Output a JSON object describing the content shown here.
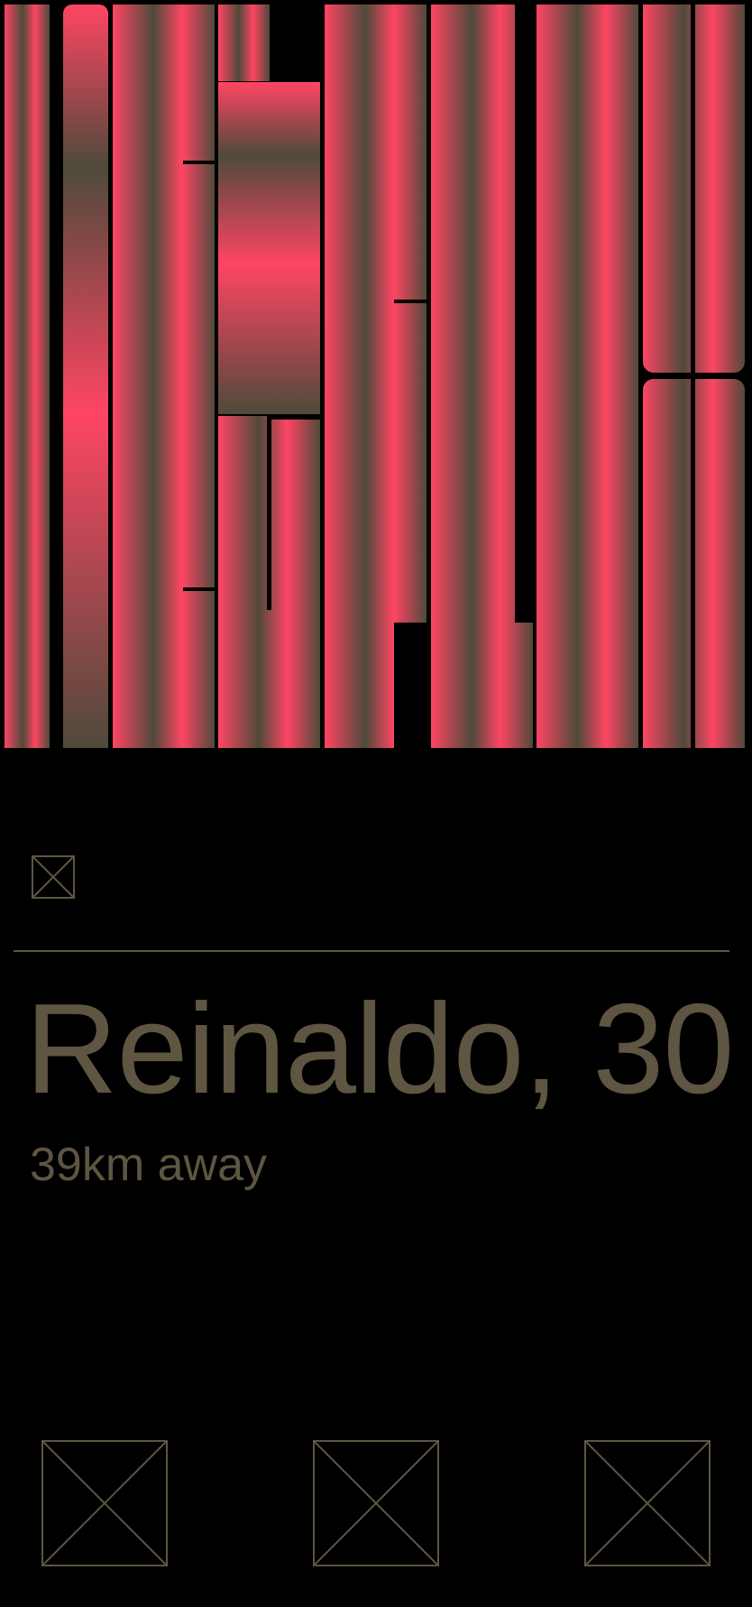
{
  "profile": {
    "name_age": "Reinaldo, 30",
    "distance": "39km away"
  },
  "icons": {
    "header": "image-placeholder-icon",
    "actions": [
      "image-placeholder-icon",
      "image-placeholder-icon",
      "image-placeholder-icon"
    ]
  },
  "colors": {
    "background": "#000000",
    "accent_pink": "#ff4563",
    "accent_olive": "#4f4a3a",
    "text_olive": "#5e5542"
  }
}
